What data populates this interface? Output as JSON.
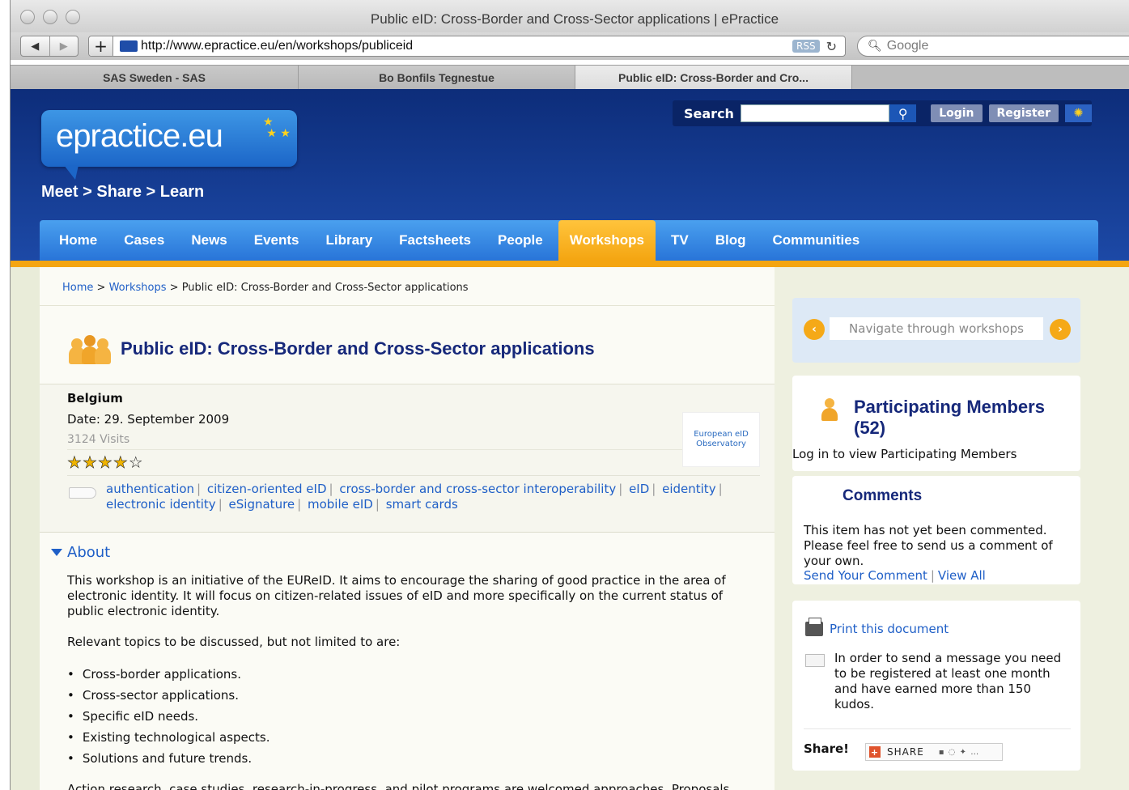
{
  "window": {
    "title": "Public eID: Cross-Border and Cross-Sector applications | ePractice",
    "url": "http://www.epractice.eu/en/workshops/publiceid",
    "rss": "RSS",
    "search_placeholder": "Google",
    "tabs": [
      {
        "label": "SAS Sweden - SAS",
        "active": false
      },
      {
        "label": "Bo Bonfils Tegnestue",
        "active": false
      },
      {
        "label": "Public eID: Cross-Border and Cro...",
        "active": true
      }
    ]
  },
  "header": {
    "logo_text": "epractice.eu",
    "tagline": "Meet > Share > Learn",
    "search_label": "Search",
    "login": "Login",
    "register": "Register"
  },
  "nav": [
    "Home",
    "Cases",
    "News",
    "Events",
    "Library",
    "Factsheets",
    "People",
    "Workshops",
    "TV",
    "Blog",
    "Communities"
  ],
  "nav_active": "Workshops",
  "breadcrumb": {
    "home": "Home",
    "sep": ">",
    "workshops": "Workshops",
    "current": "Public eID: Cross-Border and Cross-Sector applications"
  },
  "workshop": {
    "title": "Public eID: Cross-Border and Cross-Sector applications",
    "country": "Belgium",
    "date": "Date: 29. September 2009",
    "visits": "3124 Visits",
    "rating": 4,
    "rating_max": 5,
    "organizer_logo": "European eID Observatory",
    "tags": [
      "authentication",
      "citizen-oriented eID",
      "cross-border and cross-sector interoperability",
      "eID",
      "eidentity",
      "electronic identity",
      "eSignature",
      "mobile eID",
      "smart cards"
    ]
  },
  "about": {
    "heading": "About",
    "p1": "This workshop is an initiative of the EUReID. It aims to encourage the sharing of good practice in the area of electronic identity. It will focus on citizen-related issues of eID and more specifically on the current status of public electronic identity.",
    "p2": "Relevant topics to be discussed, but not limited to are:",
    "topics": [
      "Cross-border applications.",
      "Cross-sector applications.",
      "Specific eID needs.",
      "Existing technological aspects.",
      "Solutions and future trends."
    ],
    "p3": "Action research, case studies, research-in-progress, and pilot programs are welcomed approaches. Proposals"
  },
  "sidebar": {
    "navigate": "Navigate through workshops",
    "members_title": "Participating Members (52)",
    "members_note": "Log in to view Participating Members",
    "comments_title": "Comments",
    "comments_text": "This item has not yet been commented. Please feel free to send us a comment of your own.",
    "send_comment": "Send Your Comment",
    "view_all": "View All",
    "print": "Print this document",
    "message_note": "In order to send a message you need to be registered at least one month and have earned more than 150 kudos.",
    "share_label": "Share!",
    "share_button": "SHARE"
  }
}
